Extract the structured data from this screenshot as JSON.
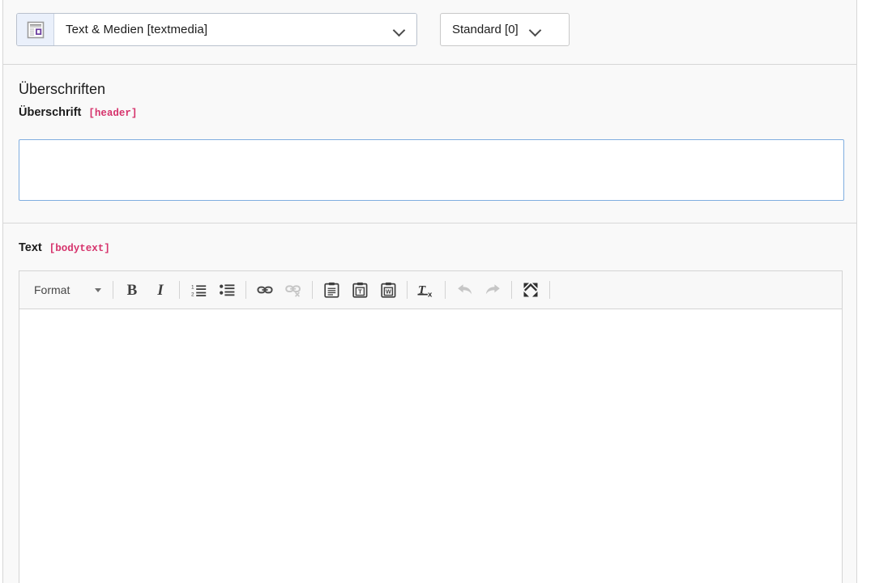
{
  "content_type": {
    "icon": "content-textmedia-icon",
    "label": "Text & Medien [textmedia]",
    "dropdown_icon": "chevron-down-icon"
  },
  "layout": {
    "label": "Standard [0]",
    "dropdown_icon": "chevron-down-icon"
  },
  "headlines_section": {
    "title": "Überschriften",
    "header_field": {
      "label": "Überschrift",
      "key": "[header]",
      "value": "",
      "placeholder": ""
    }
  },
  "body_section": {
    "bodytext_field": {
      "label": "Text",
      "key": "[bodytext]",
      "value": ""
    },
    "toolbar": {
      "format_label": "Format",
      "format_caret": "caret-down-icon",
      "buttons": [
        {
          "name": "bold-button",
          "glyph": "B",
          "title": "Bold",
          "disabled": false
        },
        {
          "name": "italic-button",
          "glyph": "I",
          "title": "Italic",
          "disabled": false
        },
        {
          "name": "numbered-list-button",
          "glyph": "numbered-list-icon",
          "title": "Insert/Remove Numbered List",
          "disabled": false
        },
        {
          "name": "bulleted-list-button",
          "glyph": "bulleted-list-icon",
          "title": "Insert/Remove Bulleted List",
          "disabled": false
        },
        {
          "name": "link-button",
          "glyph": "link-icon",
          "title": "Link",
          "disabled": false
        },
        {
          "name": "unlink-button",
          "glyph": "unlink-icon",
          "title": "Unlink",
          "disabled": true
        },
        {
          "name": "paste-button",
          "glyph": "paste-icon",
          "title": "Paste",
          "disabled": false
        },
        {
          "name": "paste-as-plain-text-button",
          "glyph": "paste-text-icon",
          "title": "Paste as plain text",
          "disabled": false
        },
        {
          "name": "paste-from-word-button",
          "glyph": "paste-word-icon",
          "title": "Paste from Word",
          "disabled": false
        },
        {
          "name": "remove-format-button",
          "glyph": "remove-format-icon",
          "title": "Remove Format",
          "disabled": false
        },
        {
          "name": "undo-button",
          "glyph": "undo-icon",
          "title": "Undo",
          "disabled": true
        },
        {
          "name": "redo-button",
          "glyph": "redo-icon",
          "title": "Redo",
          "disabled": true
        },
        {
          "name": "maximize-button",
          "glyph": "maximize-icon",
          "title": "Maximize",
          "disabled": false
        }
      ]
    }
  },
  "colors": {
    "accent_key": "#d6336c",
    "focus_border": "#80aee0",
    "panel_bg": "#f9f9f9",
    "icon_accent": "#6c3fa0"
  }
}
